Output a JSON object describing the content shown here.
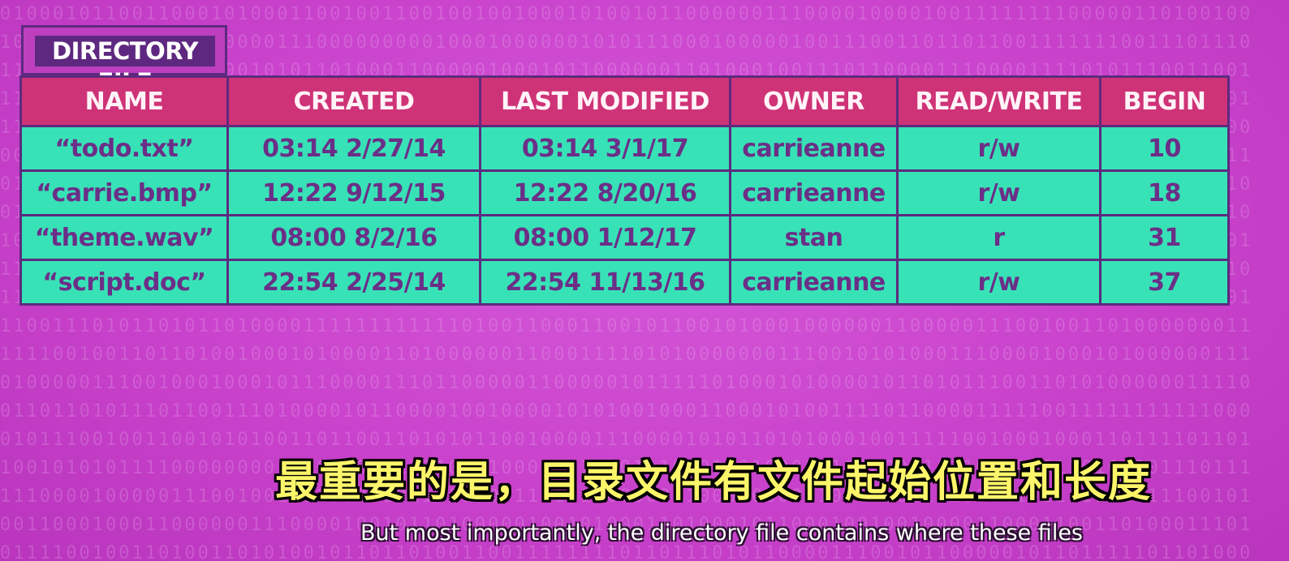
{
  "directory_label": "DIRECTORY FILE",
  "table": {
    "columns": [
      "NAME",
      "CREATED",
      "LAST MODIFIED",
      "OWNER",
      "READ/WRITE",
      "BEGIN"
    ],
    "rows": [
      [
        "“todo.txt”",
        "03:14 2/27/14",
        "03:14 3/1/17",
        "carrieanne",
        "r/w",
        "10"
      ],
      [
        "“carrie.bmp”",
        "12:22 9/12/15",
        "12:22 8/20/16",
        "carrieanne",
        "r/w",
        "18"
      ],
      [
        "“theme.wav”",
        "08:00 8/2/16",
        "08:00 1/12/17",
        "stan",
        "r",
        "31"
      ],
      [
        "“script.doc”",
        "22:54 2/25/14",
        "22:54 11/13/16",
        "carrieanne",
        "r/w",
        "37"
      ]
    ]
  },
  "subtitles": {
    "chinese": "最重要的是，目录文件有文件起始位置和长度",
    "english": "But most importantly, the directory file contains where these files"
  },
  "colors": {
    "background": "#c942cc",
    "header": "#cf3377",
    "cell": "#38e2b7",
    "border": "#5d2a7f",
    "subtitle_cn": "#fbf56a"
  }
}
